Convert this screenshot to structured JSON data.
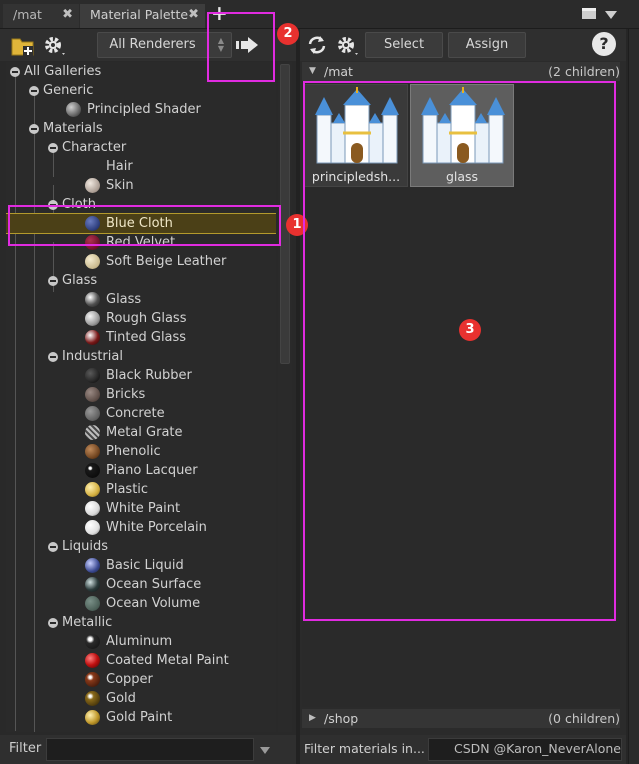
{
  "tabs": [
    {
      "label": "/mat"
    },
    {
      "label": "Material Palette"
    }
  ],
  "new_tab_label": "+",
  "left_toolbar": {
    "renderer_select": "All Renderers"
  },
  "tree": {
    "root": "All Galleries",
    "generic": "Generic",
    "principled_shader": "Principled Shader",
    "materials": "Materials",
    "character": "Character",
    "hair": "Hair",
    "skin": "Skin",
    "cloth": "Cloth",
    "blue_cloth": "Blue Cloth",
    "red_velvet": "Red Velvet",
    "soft_beige_leather": "Soft Beige Leather",
    "glass": "Glass",
    "glass_item": "Glass",
    "rough_glass": "Rough Glass",
    "tinted_glass": "Tinted Glass",
    "industrial": "Industrial",
    "black_rubber": "Black Rubber",
    "bricks": "Bricks",
    "concrete": "Concrete",
    "metal_grate": "Metal Grate",
    "phenolic": "Phenolic",
    "piano_lacquer": "Piano Lacquer",
    "plastic": "Plastic",
    "white_paint": "White Paint",
    "white_porcelain": "White Porcelain",
    "liquids": "Liquids",
    "basic_liquid": "Basic Liquid",
    "ocean_surface": "Ocean Surface",
    "ocean_volume": "Ocean Volume",
    "metallic": "Metallic",
    "aluminum": "Aluminum",
    "coated_metal_paint": "Coated Metal Paint",
    "copper": "Copper",
    "gold": "Gold",
    "gold_paint": "Gold Paint"
  },
  "left_filter": {
    "label": "Filter",
    "value": ""
  },
  "right_toolbar": {
    "select_label": "Select",
    "assign_label": "Assign",
    "help_label": "?"
  },
  "sections": {
    "mat": {
      "name": "/mat",
      "count": "(2 children)"
    },
    "shop": {
      "name": "/shop",
      "count": "(0 children)"
    }
  },
  "materials": [
    {
      "name": "principledsh..."
    },
    {
      "name": "glass"
    }
  ],
  "right_filter": {
    "label": "Filter materials in...",
    "value": ""
  },
  "watermark": "CSDN @Karon_NeverAlone",
  "annotations": [
    "1",
    "2",
    "3"
  ],
  "colors": {
    "annotation_box": "#e02be0",
    "annotation_badge": "#e8312f",
    "selection": "#4b4017"
  }
}
